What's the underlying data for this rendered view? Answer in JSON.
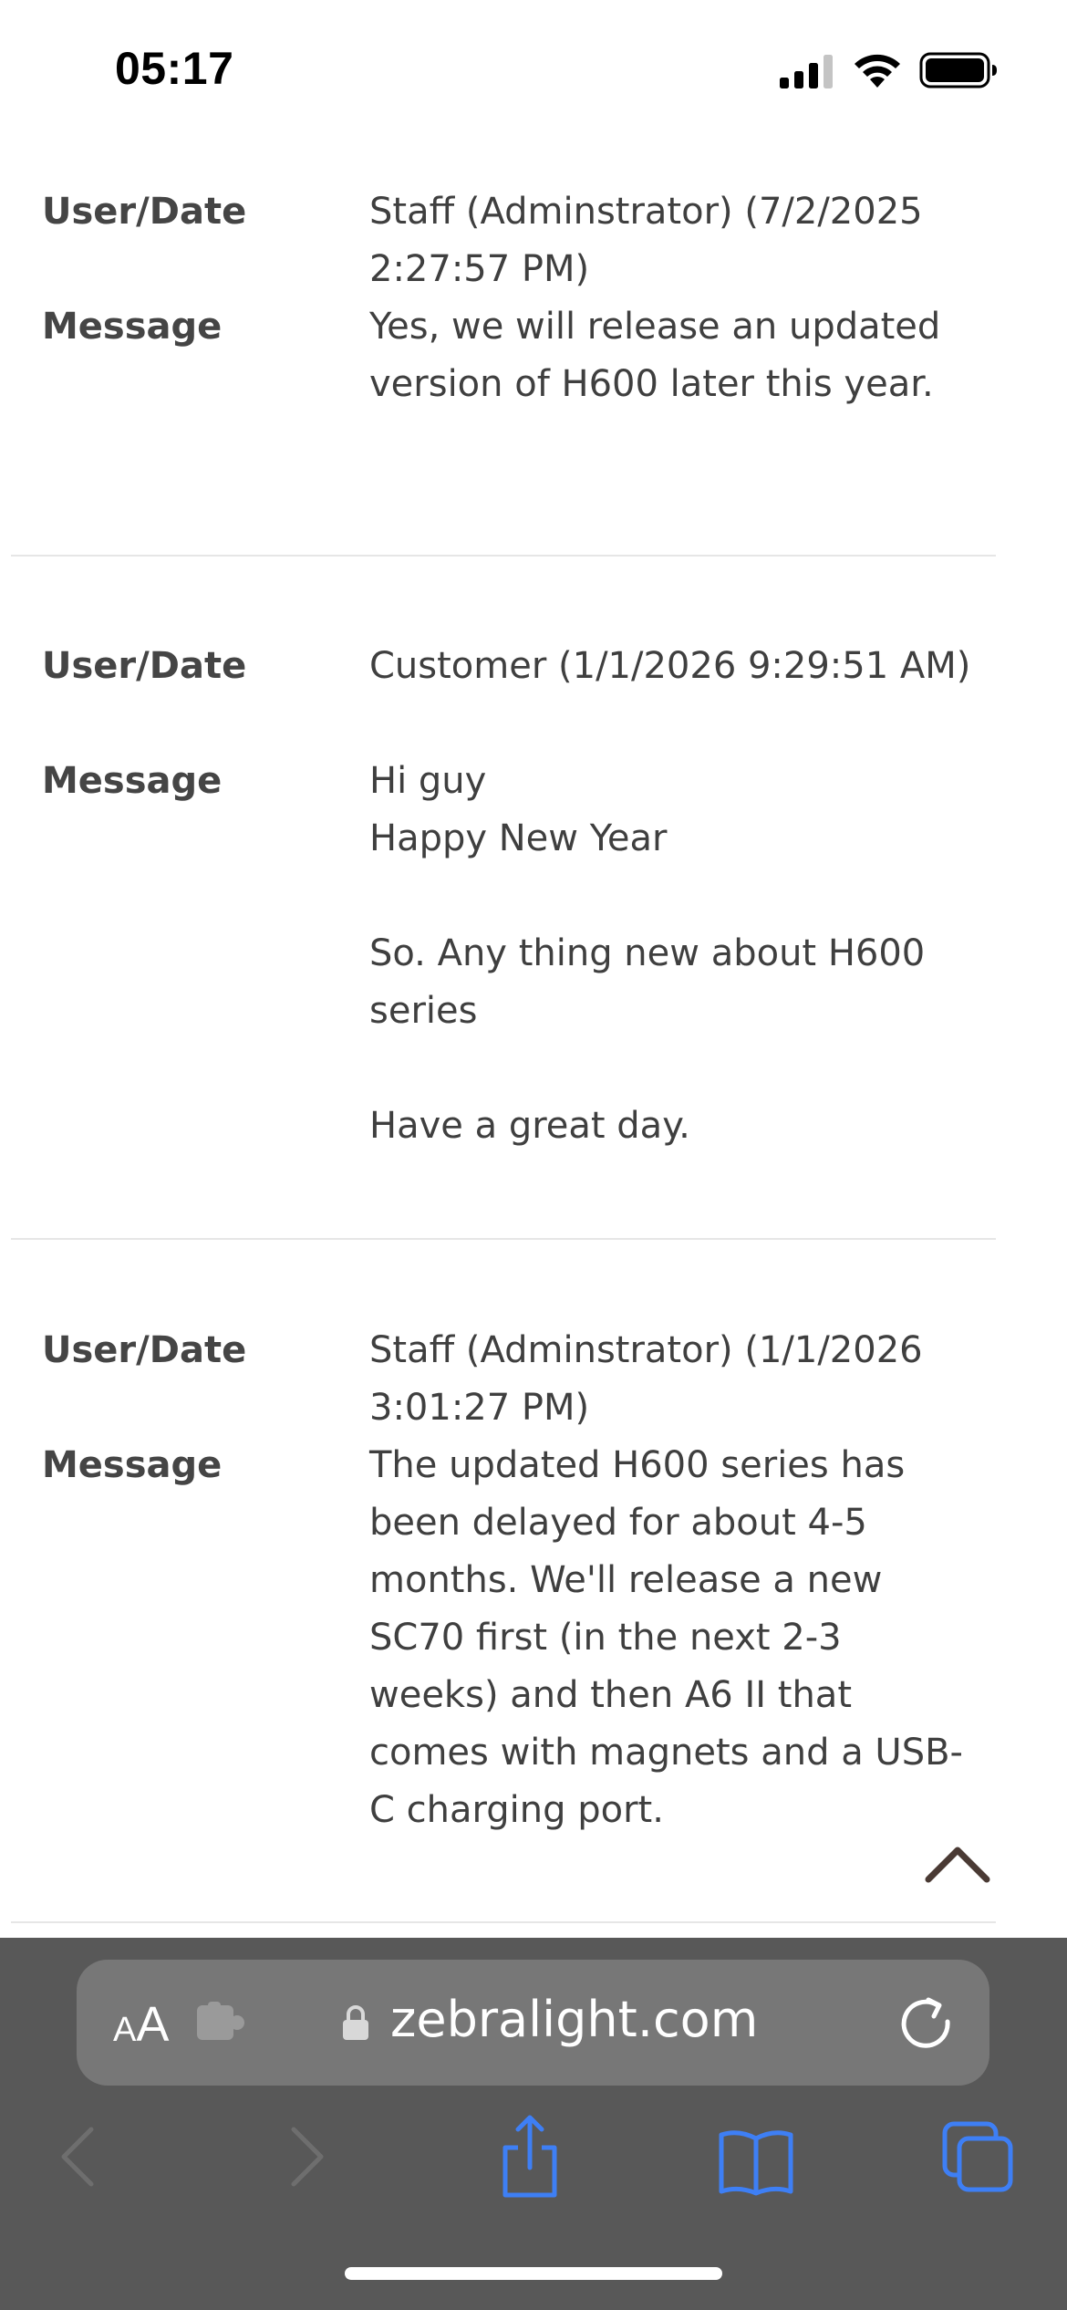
{
  "status_bar": {
    "time": "05:17"
  },
  "posts": [
    {
      "user_date_label": "User/Date",
      "user_date": "Staff (Adminstrator) (7/2/2025 2:27:57 PM)",
      "message_label": "Message",
      "message": "Yes, we will release an updated version of H600 later this year."
    },
    {
      "user_date_label": "User/Date",
      "user_date": "Customer (1/1/2026 9:29:51 AM)",
      "message_label": "Message",
      "message": "Hi guy\nHappy New Year\n\nSo. Any thing new about H600 series\n\nHave a great day."
    },
    {
      "user_date_label": "User/Date",
      "user_date": "Staff (Adminstrator) (1/1/2026 3:01:27 PM)",
      "message_label": "Message",
      "message": "The updated H600 series has been delayed for about 4-5 months. We'll release a new SC70 first (in the next 2-3 weeks) and then A6 II that comes with magnets and a USB-C charging port."
    }
  ],
  "browser": {
    "text_size_small": "A",
    "text_size_big": "A",
    "url": "zebralight.com"
  },
  "colors": {
    "browser_bar": "#585858",
    "address_bar": "#777777",
    "accent_blue": "#3e7ff5",
    "scroll_top_arrow": "#4a3a34"
  }
}
